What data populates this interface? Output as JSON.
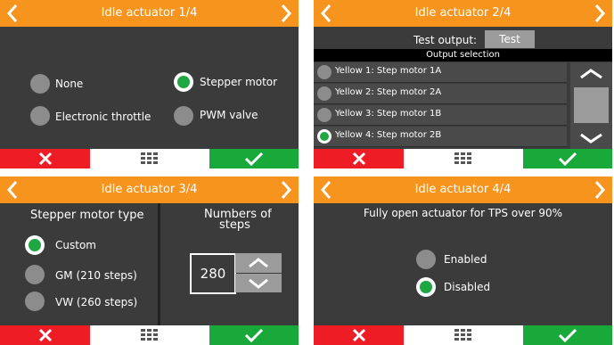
{
  "colors": {
    "title_bar": "#f7941d",
    "cancel": "#ee1c24",
    "confirm": "#19a93b",
    "panel": "#3b3b3b",
    "radio_on": "#1fa742"
  },
  "panel1": {
    "title": "Idle actuator 1/4",
    "options": [
      {
        "label": "None",
        "selected": false
      },
      {
        "label": "Stepper motor",
        "selected": true
      },
      {
        "label": "Electronic throttle",
        "selected": false
      },
      {
        "label": "PWM valve",
        "selected": false
      }
    ]
  },
  "panel2": {
    "title": "Idle actuator 2/4",
    "test_output_label": "Test output:",
    "test_button": "Test",
    "section_header": "Output selection",
    "outputs": [
      {
        "label": "Yellow 1: Step motor 1A",
        "selected": false
      },
      {
        "label": "Yellow 2: Step motor 2A",
        "selected": false
      },
      {
        "label": "Yellow 3: Step motor 1B",
        "selected": false
      },
      {
        "label": "Yellow 4: Step motor 2B",
        "selected": true
      }
    ]
  },
  "panel3": {
    "title": "Idle actuator 3/4",
    "type_heading": "Stepper motor type",
    "steps_heading_line1": "Numbers of",
    "steps_heading_line2": "steps",
    "steps_value": "280",
    "options": [
      {
        "label": "Custom",
        "selected": true
      },
      {
        "label": "GM (210 steps)",
        "selected": false
      },
      {
        "label": "VW (260 steps)",
        "selected": false
      }
    ]
  },
  "panel4": {
    "title": "Idle actuator 4/4",
    "question": "Fully open actuator for TPS over 90%",
    "options": [
      {
        "label": "Enabled",
        "selected": false
      },
      {
        "label": "Disabled",
        "selected": true
      }
    ]
  }
}
